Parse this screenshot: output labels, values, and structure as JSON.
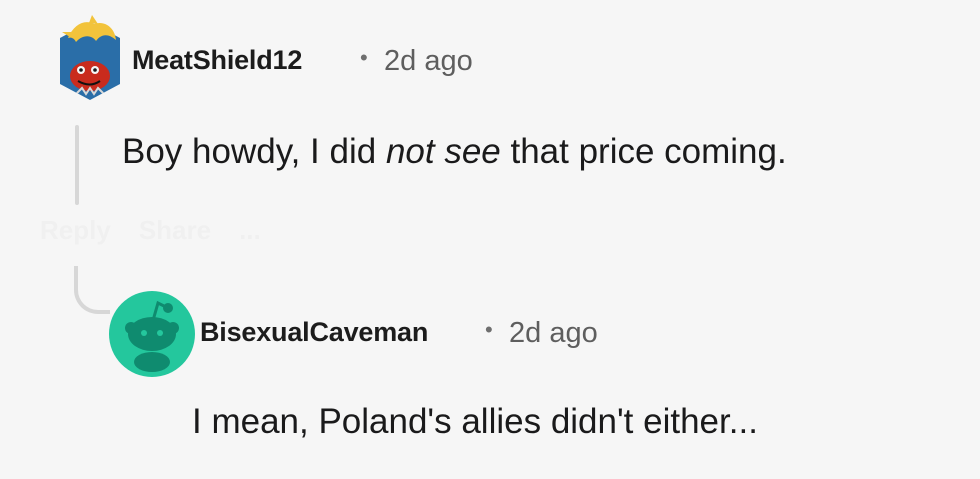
{
  "comments": [
    {
      "author": "MeatShield12",
      "separator": "•",
      "time": "2d ago",
      "body_parts": {
        "before": "Boy howdy, I did ",
        "emphasis": "not see",
        "after": " that price coming."
      },
      "ghost_actions": [
        "Reply",
        "Share",
        "..."
      ]
    },
    {
      "author": "BisexualCaveman",
      "separator": "•",
      "time": "2d ago",
      "body": "I mean, Poland's allies didn't either..."
    }
  ],
  "colors": {
    "background": "#f6f6f6",
    "text": "#1a1a1b",
    "meta": "#5e5e5e",
    "thread_line": "#d7d7d7",
    "avatar_teal": "#24c79d",
    "avatar_teal_dark": "#0f8b6f",
    "hex_avatar_blue": "#2a6ea8",
    "hex_avatar_red": "#c92b1d",
    "hex_avatar_yellow": "#f2c33b"
  },
  "icons": {
    "comment_1_avatar": "snoo-hex-avatar-icon",
    "comment_2_avatar": "snoo-default-avatar-icon",
    "thread_connector": "thread-connector-icon"
  }
}
